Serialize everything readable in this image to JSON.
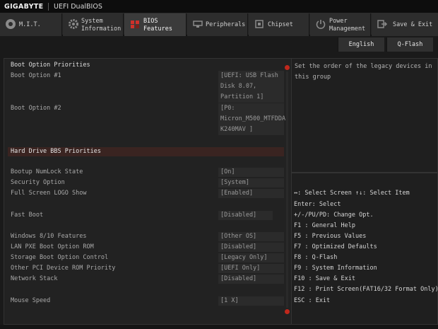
{
  "titlebar": {
    "brand": "GIGABYTE",
    "app_title": "UEFI DualBIOS"
  },
  "tabs": [
    {
      "label": "M.I.T.",
      "icon": "dial-icon",
      "active": false
    },
    {
      "label": "System\nInformation",
      "icon": "gear-icon",
      "active": false
    },
    {
      "label": "BIOS\nFeatures",
      "icon": "bios-chip-icon",
      "active": true
    },
    {
      "label": "Peripherals",
      "icon": "peripherals-icon",
      "active": false
    },
    {
      "label": "Chipset",
      "icon": "chip-icon",
      "active": false
    },
    {
      "label": "Power\nManagement",
      "icon": "power-icon",
      "active": false
    },
    {
      "label": "Save & Exit",
      "icon": "exit-icon",
      "active": false
    }
  ],
  "subbar": {
    "language": "English",
    "qflash": "Q-Flash"
  },
  "settings": {
    "boot_priorities_header": "Boot Option Priorities",
    "boot_option_1": {
      "label": "Boot Option #1",
      "value": [
        "[UEFI: USB Flash",
        "Disk 8.07,",
        "Partition 1]"
      ]
    },
    "boot_option_2": {
      "label": "Boot Option #2",
      "value": [
        "[P0:",
        "Micron_M500_MTFDDA",
        "K240MAV ]"
      ]
    },
    "hdd_bbs": "Hard Drive BBS Priorities",
    "numlock": {
      "label": "Bootup NumLock State",
      "value": "[On]"
    },
    "security": {
      "label": "Security Option",
      "value": "[System]"
    },
    "logo": {
      "label": "Full Screen LOGO Show",
      "value": "[Enabled]"
    },
    "fast_boot": {
      "label": "Fast Boot",
      "value": "[Disabled]"
    },
    "windows_features": {
      "label": "Windows 8/10 Features",
      "value": "[Other OS]"
    },
    "lan_pxe": {
      "label": "LAN PXE Boot Option ROM",
      "value": "[Disabled]"
    },
    "storage_boot": {
      "label": "Storage Boot Option Control",
      "value": "[Legacy Only]"
    },
    "pci_rom": {
      "label": "Other PCI Device ROM Priority",
      "value": "[UEFI Only]"
    },
    "network_stack": {
      "label": "Network Stack",
      "value": "[Disabled]"
    },
    "mouse_speed": {
      "label": "Mouse Speed",
      "value": "[1 X]"
    }
  },
  "help": {
    "text": "Set the order of the legacy devices in this group"
  },
  "keys": [
    "↔: Select Screen  ↑↓: Select Item",
    "Enter: Select",
    "+/-/PU/PD: Change Opt.",
    "F1  : General Help",
    "F5  : Previous Values",
    "F7  : Optimized Defaults",
    "F8  : Q-Flash",
    "F9  : System Information",
    "F10 : Save & Exit",
    "F12 : Print Screen(FAT16/32 Format Only)",
    "ESC : Exit"
  ],
  "colors": {
    "accent": "#c0281c",
    "highlight": "#3a2421",
    "active_tab": "#3b3b3b"
  }
}
